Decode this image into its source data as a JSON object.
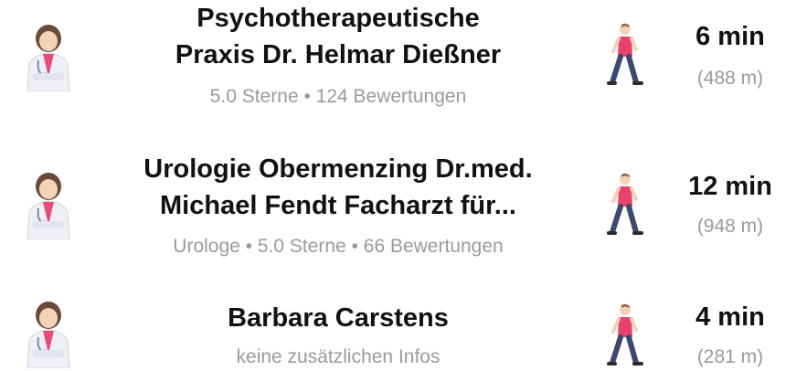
{
  "results": [
    {
      "icon": "doctor-icon",
      "title": "Psychotherapeutische\nPraxis Dr. Helmar Dießner",
      "subtitle": "5.0 Sterne • 124 Bewertungen",
      "walk_icon": "walking-person-icon",
      "time": "6 min",
      "distance": "(488 m)"
    },
    {
      "icon": "doctor-icon",
      "title": "Urologie Obermenzing Dr.med.\nMichael Fendt Facharzt für...",
      "subtitle": "Urologe • 5.0 Sterne • 66 Bewertungen",
      "walk_icon": "walking-person-icon",
      "time": "12 min",
      "distance": "(948 m)"
    },
    {
      "icon": "doctor-icon",
      "title": "Barbara Carstens",
      "subtitle": "keine zusätzlichen Infos",
      "walk_icon": "walking-person-icon",
      "time": "4 min",
      "distance": "(281 m)"
    }
  ],
  "colors": {
    "title": "#111111",
    "secondary": "#9a9a9a",
    "shirt": "#e8416b",
    "scrubs": "#e84a7a",
    "pants": "#3b4a6b"
  }
}
